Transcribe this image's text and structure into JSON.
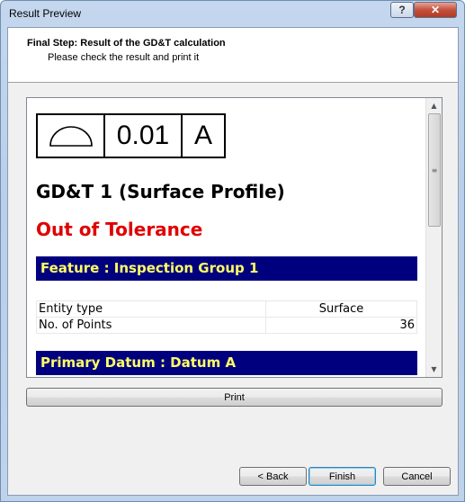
{
  "window": {
    "title": "Result Preview",
    "help_label": "?",
    "close_label": "✕"
  },
  "header": {
    "title": "Final Step: Result of the GD&T calculation",
    "subtitle": "Please check the result and print it"
  },
  "preview": {
    "frame": {
      "symbol": "surface-profile-icon",
      "tolerance": "0.01",
      "datum": "A"
    },
    "gdt_title": "GD&T 1 (Surface Profile)",
    "status": "Out of Tolerance",
    "status_color": "#e00000",
    "feature_section": "Feature : Inspection Group 1",
    "feature_table": [
      {
        "label": "Entity type",
        "value": "Surface"
      },
      {
        "label": "No. of Points",
        "value": "36"
      }
    ],
    "datum_section": "Primary Datum : Datum A",
    "section_color": "#00007f",
    "section_text_color": "#ffff66"
  },
  "buttons": {
    "print": "Print",
    "back": "< Back",
    "finish": "Finish",
    "cancel": "Cancel"
  }
}
